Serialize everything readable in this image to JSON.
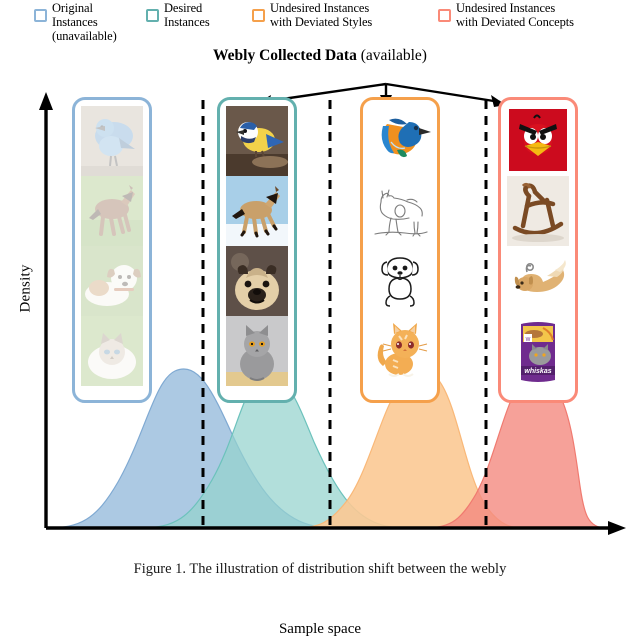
{
  "legend": {
    "items": [
      {
        "id": "original",
        "label": "Original\nInstances\n(unavailable)",
        "color": "#8cb4d8",
        "icon": "square-outline-icon"
      },
      {
        "id": "desired",
        "label": "Desired\nInstances",
        "color": "#63b0ae",
        "icon": "square-outline-icon"
      },
      {
        "id": "styles",
        "label": "Undesired Instances\nwith Deviated Styles",
        "color": "#f5a04b",
        "icon": "square-outline-icon"
      },
      {
        "id": "concepts",
        "label": "Undesired Instances\nwith Deviated Concepts",
        "color": "#fa8a78",
        "icon": "square-outline-icon"
      }
    ]
  },
  "webly": {
    "title_bold": "Webly Collected Data",
    "title_rest": " (available)",
    "arrow_icon": "arrow-down-icon"
  },
  "axes": {
    "ylabel": "Density",
    "xlabel": "Sample space",
    "y_arrow_icon": "axis-arrow-up-icon",
    "x_arrow_icon": "axis-arrow-right-icon"
  },
  "columns": [
    {
      "id": "original",
      "name": "original-instances-column",
      "border_color": "#8cb4d8",
      "faded": true,
      "cells": [
        {
          "name": "photo-bird",
          "caption": "blue bird photo"
        },
        {
          "name": "photo-horse",
          "caption": "brown horse running photo"
        },
        {
          "name": "photo-dog",
          "caption": "jack russell puppy photo"
        },
        {
          "name": "photo-cat",
          "caption": "fluffy birman cat photo"
        }
      ]
    },
    {
      "id": "desired",
      "name": "desired-instances-column",
      "border_color": "#63b0ae",
      "faded": false,
      "cells": [
        {
          "name": "photo-blue-tit",
          "caption": "blue tit on branch photo"
        },
        {
          "name": "photo-horse-snow",
          "caption": "tan horse in snow photo"
        },
        {
          "name": "photo-pug",
          "caption": "pug face photo"
        },
        {
          "name": "photo-grey-cat",
          "caption": "british shorthair cat photo"
        }
      ]
    },
    {
      "id": "styles",
      "name": "deviated-styles-column",
      "border_color": "#f5a04b",
      "faded": false,
      "cells": [
        {
          "name": "clipart-kingfisher",
          "caption": "kingfisher clipart illustration"
        },
        {
          "name": "sketch-horse",
          "caption": "pencil sketch of a horse"
        },
        {
          "name": "lineart-dog",
          "caption": "line drawing of a puppy"
        },
        {
          "name": "cartoon-cat",
          "caption": "orange cartoon kitten"
        }
      ]
    },
    {
      "id": "concepts",
      "name": "deviated-concepts-column",
      "border_color": "#fa8a78",
      "faded": false,
      "cells": [
        {
          "name": "logo-angry-birds",
          "caption": "Angry Birds red bird logo"
        },
        {
          "name": "object-rocking-horse",
          "caption": "wooden rocking horse toy"
        },
        {
          "name": "object-dog-toy",
          "caption": "plush dog chew toy"
        },
        {
          "name": "product-whiskas",
          "caption": "Whiskas cat food bag"
        }
      ]
    }
  ],
  "chart_data": {
    "type": "area",
    "title": "",
    "xlabel": "Sample space",
    "ylabel": "Density",
    "grid": false,
    "legend_position": "top",
    "xlim": [
      0,
      1
    ],
    "ylim": [
      0,
      1
    ],
    "dividers": [
      0.255,
      0.493,
      0.76
    ],
    "series": [
      {
        "name": "Original Instances (unavailable)",
        "color": "#8cb4d8",
        "fill_opacity": 0.72,
        "peak_x": 0.3,
        "peak_y": 0.97,
        "spread": 0.115
      },
      {
        "name": "Desired Instances",
        "color": "#94d2cd",
        "fill_opacity": 0.72,
        "peak_x": 0.41,
        "peak_y": 0.97,
        "spread": 0.105
      },
      {
        "name": "Undesired Instances with Deviated Styles",
        "color": "#fbc993",
        "fill_opacity": 0.85,
        "peak_x": 0.655,
        "peak_y": 1.0,
        "spread": 0.105
      },
      {
        "name": "Undesired Instances with Deviated Concepts",
        "color": "#f4897f",
        "fill_opacity": 0.78,
        "peak_x": 0.855,
        "peak_y": 0.98,
        "spread": 0.095
      }
    ]
  },
  "caption": {
    "text": "Figure 1. The illustration of distribution shift between the webly"
  }
}
